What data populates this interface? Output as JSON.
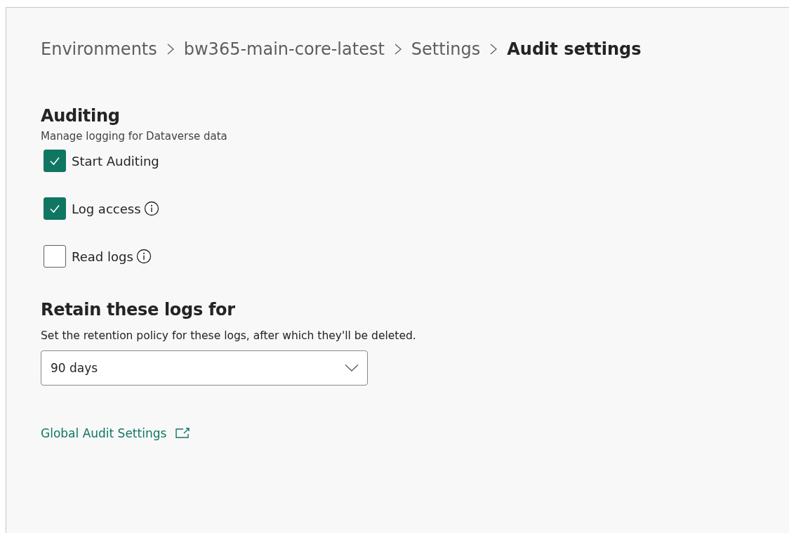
{
  "breadcrumb": [
    {
      "label": "Environments",
      "current": false
    },
    {
      "label": "bw365-main-core-latest",
      "current": false
    },
    {
      "label": "Settings",
      "current": false
    },
    {
      "label": "Audit settings",
      "current": true
    }
  ],
  "auditing": {
    "title": "Auditing",
    "description": "Manage logging for Dataverse data",
    "options": [
      {
        "label": "Start Auditing",
        "checked": true,
        "info": false
      },
      {
        "label": "Log access",
        "checked": true,
        "info": true
      },
      {
        "label": "Read logs",
        "checked": false,
        "info": true
      }
    ]
  },
  "retention": {
    "title": "Retain these logs for",
    "description": "Set the retention policy for these logs, after which they'll be deleted.",
    "dropdown": {
      "value": "90 days"
    }
  },
  "link": {
    "label": "Global Audit Settings"
  }
}
